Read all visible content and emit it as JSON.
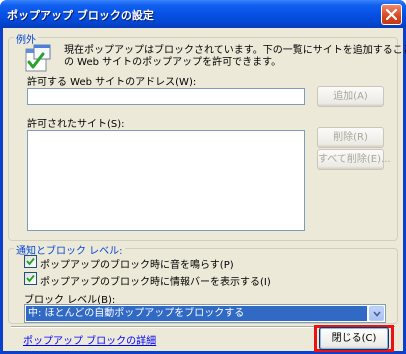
{
  "window": {
    "title": "ポップアップ ブロックの設定"
  },
  "exceptions": {
    "legend": "例外",
    "info_line1": "現在ポップアップはブロックされています。下の一覧にサイトを追加することにより、特定",
    "info_line2": "の Web サイトのポップアップを許可できます。",
    "address_label": "許可する Web サイトのアドレス(W):",
    "address_value": "",
    "add_button": "追加(A)",
    "allowed_label": "許可されたサイト(S):",
    "allowed_sites": [],
    "remove_button": "削除(R)",
    "remove_all_button": "すべて削除(E)..."
  },
  "notifications": {
    "legend": "通知とブロック レベル:",
    "sound_label": "ポップアップのブロック時に音を鳴らす(P)",
    "sound_checked": true,
    "infobar_label": "ポップアップのブロック時に情報バーを表示する(I)",
    "infobar_checked": true,
    "level_label": "ブロック レベル(B):",
    "level_value": "中: ほとんどの自動ポップアップをブロックする"
  },
  "footer": {
    "details_link": "ポップアップ ブロックの詳細",
    "close_button": "閉じる(C)"
  },
  "colors": {
    "title_bar": "#0551e6",
    "dialog_bg": "#ece9d8",
    "legend_text": "#0046d5",
    "selection": "#316ac5",
    "highlight": "#ee1111",
    "link": "#0000ff"
  }
}
